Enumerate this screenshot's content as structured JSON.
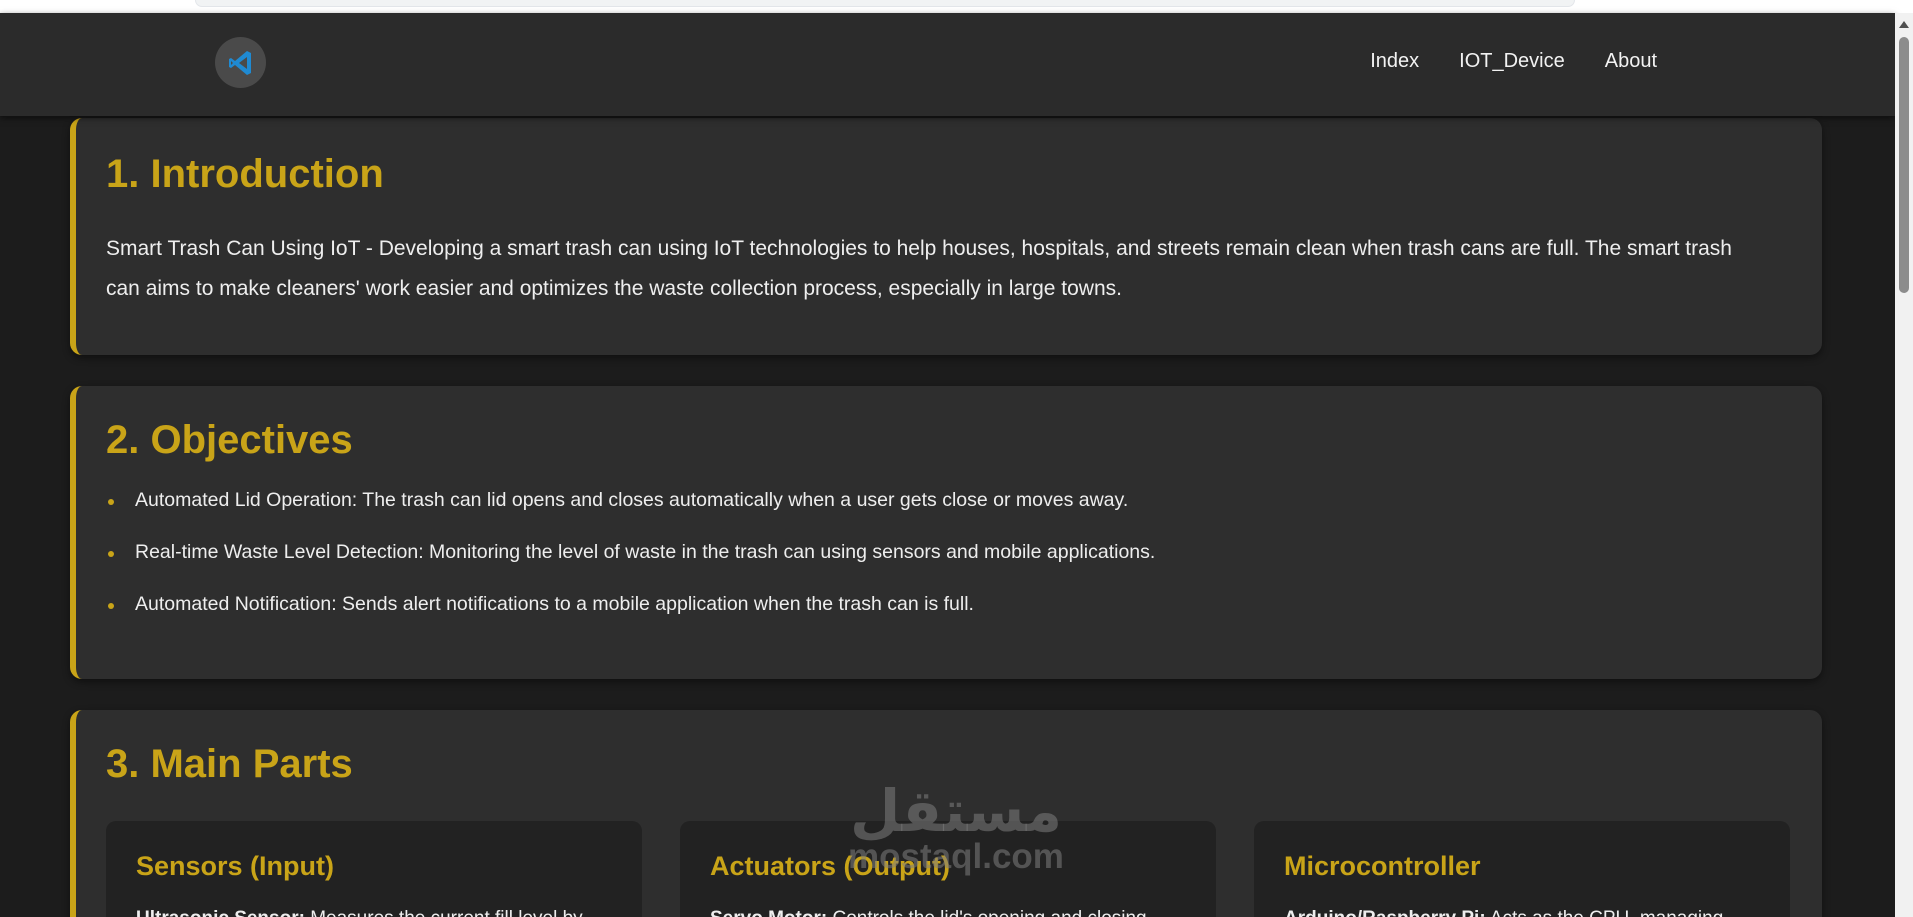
{
  "navbar": {
    "logo_icon": "vscode-logo-icon",
    "links": [
      "Index",
      "IOT_Device",
      "About"
    ]
  },
  "introduction": {
    "title": "1. Introduction",
    "text": "Smart Trash Can Using IoT - Developing a smart trash can using IoT technologies to help houses, hospitals, and streets remain clean when trash cans are full. The smart trash can aims to make cleaners' work easier and optimizes the waste collection process, especially in large towns."
  },
  "objectives": {
    "title": "2. Objectives",
    "items": [
      "Automated Lid Operation: The trash can lid opens and closes automatically when a user gets close or moves away.",
      "Real-time Waste Level Detection: Monitoring the level of waste in the trash can using sensors and mobile applications.",
      "Automated Notification: Sends alert notifications to a mobile application when the trash can is full."
    ]
  },
  "main_parts": {
    "title": "3. Main Parts",
    "cards": [
      {
        "title": "Sensors (Input)",
        "term": "Ultrasonic Sensor:",
        "text": " Measures the current fill level by"
      },
      {
        "title": "Actuators (Output)",
        "term": "Servo Motor:",
        "text": " Controls the lid's opening and closing"
      },
      {
        "title": "Microcontroller",
        "term": "Arduino/Raspberry Pi:",
        "text": " Acts as the CPU, managing"
      }
    ]
  },
  "watermark": {
    "arabic": "مستقل",
    "latin": "mostaql.com"
  },
  "colors": {
    "accent": "#c9a418",
    "background": "#1c1c1c",
    "navbar": "#2b2b2b",
    "card": "#2e2e2e",
    "inner_card": "#222222"
  }
}
